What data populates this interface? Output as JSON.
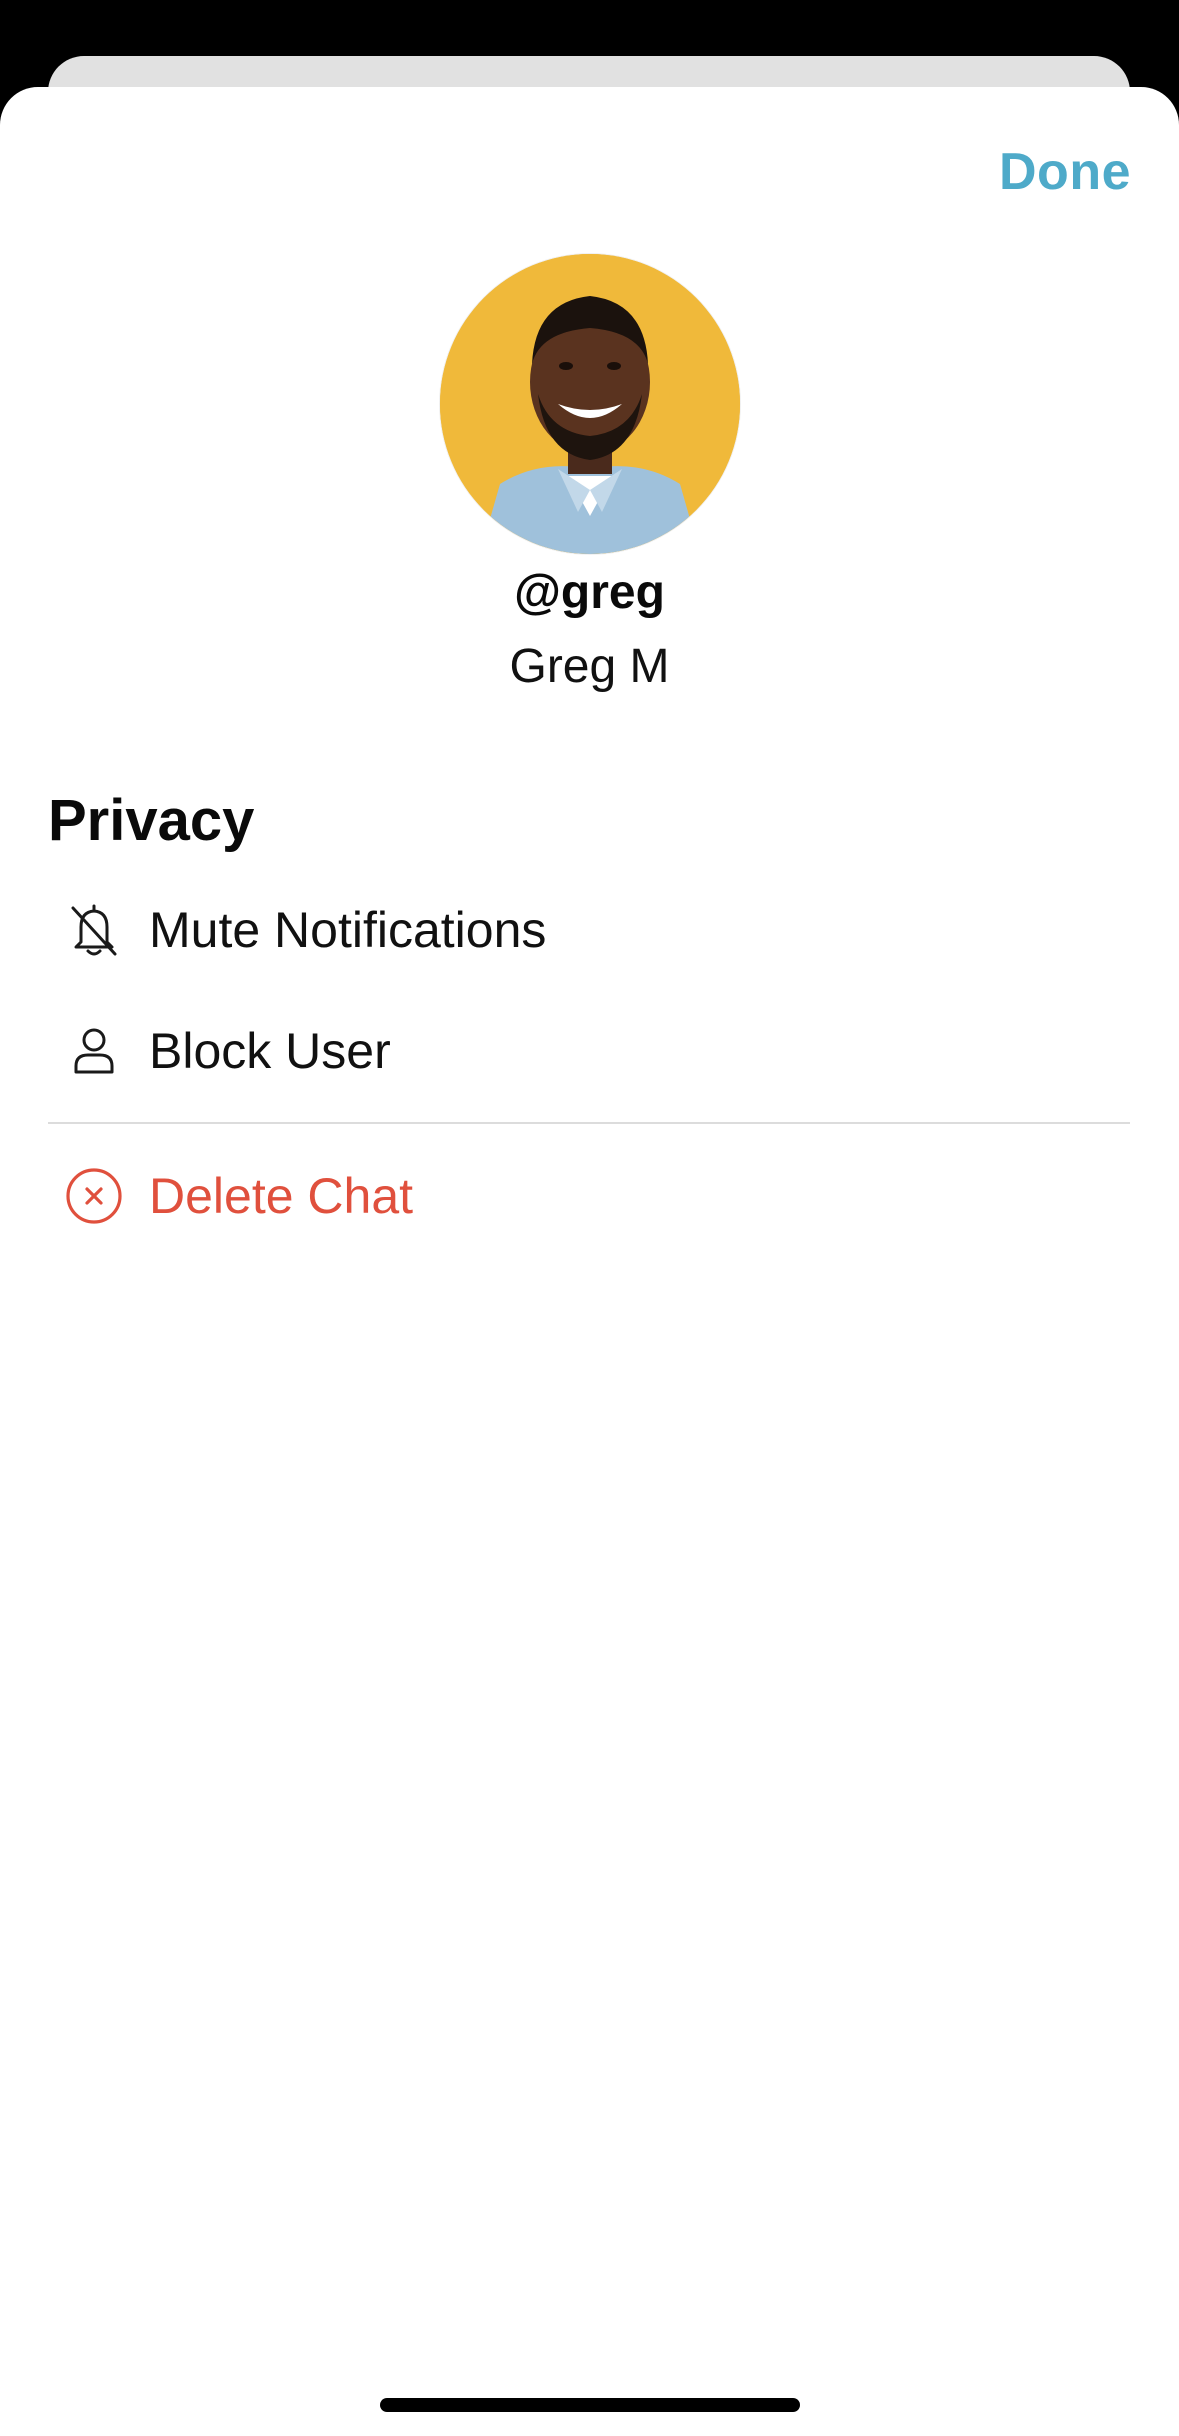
{
  "header": {
    "done_label": "Done"
  },
  "profile": {
    "username": "@greg",
    "full_name": "Greg M",
    "avatar_icon": "profile-photo"
  },
  "privacy": {
    "title": "Privacy",
    "items": [
      {
        "label": "Mute Notifications",
        "icon": "bell-slash-icon"
      },
      {
        "label": "Block User",
        "icon": "person-icon"
      }
    ]
  },
  "danger": {
    "delete_label": "Delete Chat",
    "icon": "x-circle-icon"
  },
  "colors": {
    "accent": "#4eaac9",
    "destructive": "#e0503d",
    "avatar_bg": "#f0b93a"
  }
}
